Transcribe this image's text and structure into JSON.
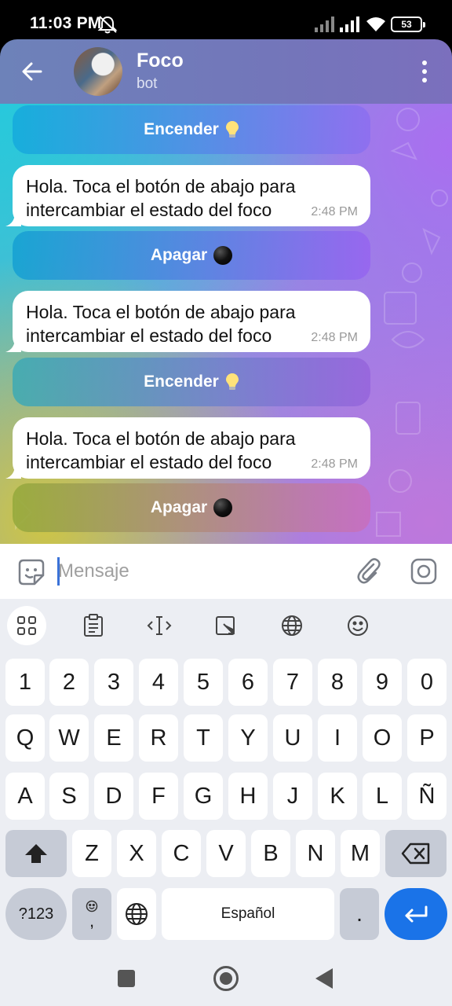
{
  "status_bar": {
    "time": "11:03 PM",
    "battery": "53",
    "icons": [
      "mute-icon",
      "signal-icon",
      "signal-icon",
      "wifi-icon",
      "battery-icon"
    ]
  },
  "header": {
    "title": "Foco",
    "subtitle": "bot",
    "back_icon": "arrow-left-icon",
    "menu_icon": "more-vertical-icon"
  },
  "chat": {
    "bot_buttons": [
      {
        "label": "Encender",
        "emoji": "light-bulb-icon"
      },
      {
        "label": "Apagar",
        "emoji": "black-circle-icon"
      },
      {
        "label": "Encender",
        "emoji": "light-bulb-icon"
      },
      {
        "label": "Apagar",
        "emoji": "black-circle-icon"
      }
    ],
    "messages": [
      {
        "text": "Hola. Toca el botón de abajo para intercambiar el estado del foco",
        "time": "2:48 PM"
      },
      {
        "text": "Hola. Toca el botón de abajo para intercambiar el estado del foco",
        "time": "2:48 PM"
      },
      {
        "text": "Hola. Toca el botón de abajo para intercambiar el estado del foco",
        "time": "2:48 PM"
      }
    ]
  },
  "input": {
    "placeholder": "Mensaje",
    "value": ""
  },
  "keyboard": {
    "toolbar": [
      "apps-icon",
      "clipboard-icon",
      "text-cursor-icon",
      "resize-icon",
      "globe-icon",
      "emoji-icon"
    ],
    "row_numbers": [
      "1",
      "2",
      "3",
      "4",
      "5",
      "6",
      "7",
      "8",
      "9",
      "0"
    ],
    "row1": [
      "Q",
      "W",
      "E",
      "R",
      "T",
      "Y",
      "U",
      "I",
      "O",
      "P"
    ],
    "row2": [
      "A",
      "S",
      "D",
      "F",
      "G",
      "H",
      "J",
      "K",
      "L",
      "Ñ"
    ],
    "row3": [
      "Z",
      "X",
      "C",
      "V",
      "B",
      "N",
      "M"
    ],
    "symbols_label": "?123",
    "comma_label": ",",
    "space_label": "Español",
    "period_label": "."
  },
  "colors": {
    "header": "#7376ba",
    "enter_key": "#1a73e8",
    "caret": "#3a72d8"
  }
}
